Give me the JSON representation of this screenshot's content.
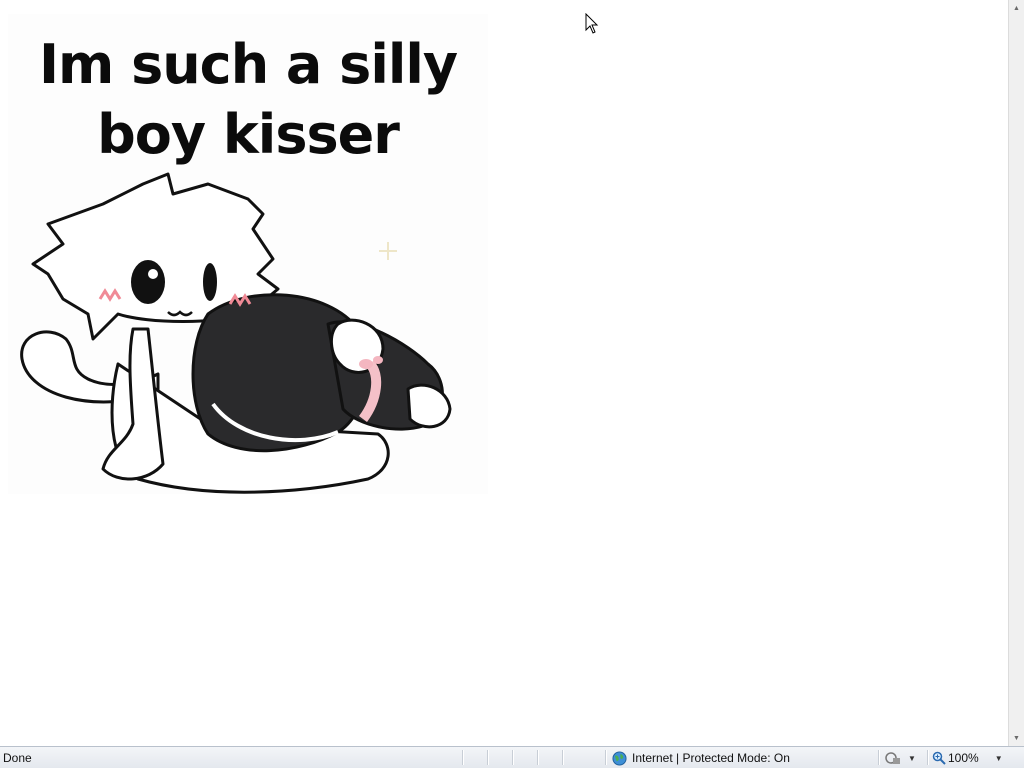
{
  "meme": {
    "caption": "Im such a silly\nboy kisser"
  },
  "statusbar": {
    "status": "Done",
    "zone": "Internet | Protected Mode: On",
    "zoom": "100%",
    "icons": [
      "globe-icon",
      "security-icon",
      "zoom-icon",
      "dropdown-arrow-icon"
    ]
  },
  "colors": {
    "statusbar_bg": "#e8ecf1",
    "caption": "#0b0b0b",
    "creature_dark": "#2a2a2c",
    "blush": "#f08a96"
  }
}
